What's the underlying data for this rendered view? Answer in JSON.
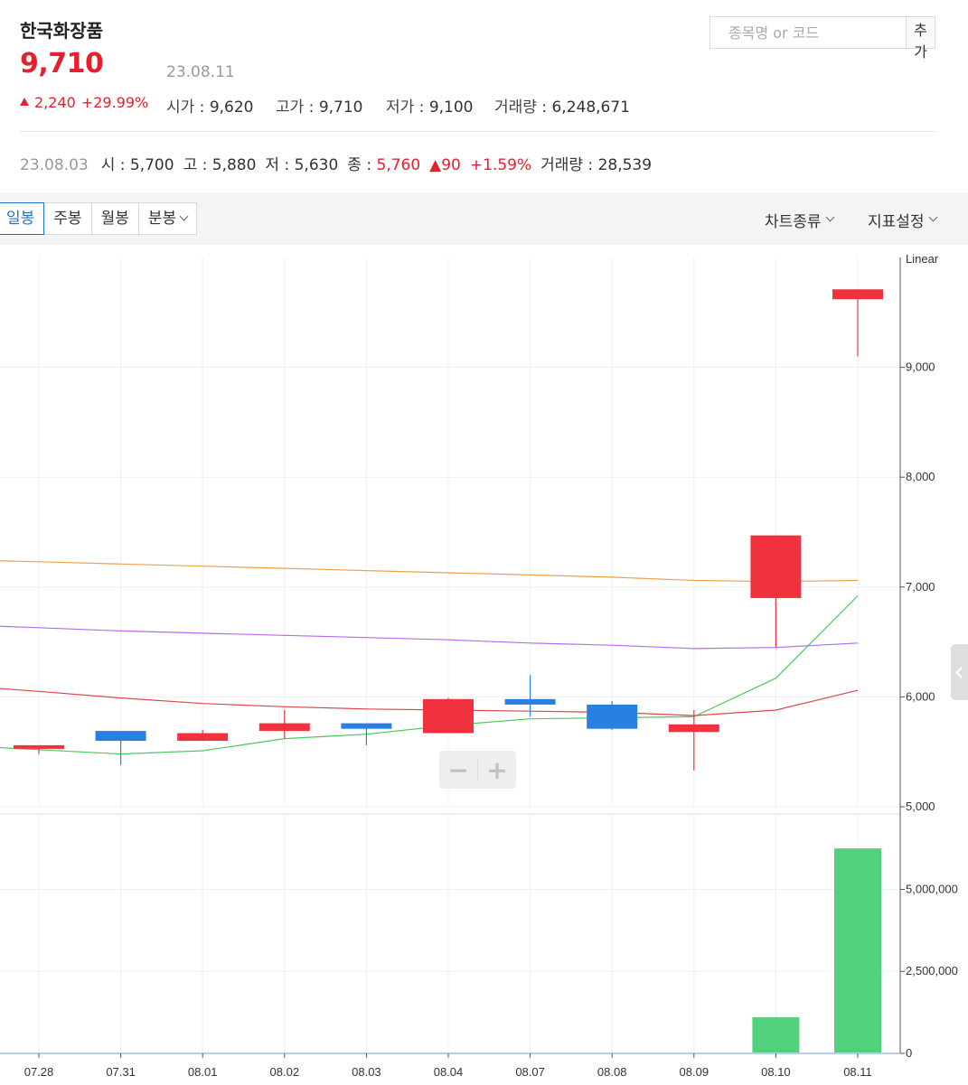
{
  "header": {
    "name": "한국화장품",
    "price": "9,710",
    "date": "23.08.11",
    "change": "2,240",
    "change_pct": "+29.99%",
    "open_label": "시가",
    "open": "9,620",
    "high_label": "고가",
    "high": "9,710",
    "low_label": "저가",
    "low": "9,100",
    "volume_label": "거래량",
    "volume": "6,248,671"
  },
  "prev_day": {
    "date": "23.08.03",
    "open_label": "시",
    "open": "5,700",
    "high_label": "고",
    "high": "5,880",
    "low_label": "저",
    "low": "5,630",
    "close_label": "종",
    "close": "5,760",
    "change": "▲90",
    "change_pct": "+1.59%",
    "volume_label": "거래량",
    "volume": "28,539"
  },
  "search": {
    "placeholder": "종목명 or 코드",
    "button": "추가"
  },
  "toolbar": {
    "periods": [
      "일봉",
      "주봉",
      "월봉",
      "분봉"
    ],
    "chart_type": "차트종류",
    "indicator": "지표설정"
  },
  "zoom": {
    "minus": "−",
    "plus": "+"
  },
  "colors": {
    "up": "#f0323f",
    "down": "#2a80e0",
    "volume": "#52d17c",
    "ma5": "#4cc95e",
    "ma20": "#e0474b",
    "ma60": "#b26cf0",
    "ma120": "#f0a04a"
  },
  "chart_data": {
    "type": "candlestick",
    "scale_label": "Linear",
    "dates": [
      "07.28",
      "07.31",
      "08.01",
      "08.02",
      "08.03",
      "08.04",
      "08.07",
      "08.08",
      "08.09",
      "08.10",
      "08.11"
    ],
    "ohlc": [
      {
        "o": 5530,
        "h": 5560,
        "l": 5480,
        "c": 5560
      },
      {
        "o": 5690,
        "h": 5690,
        "l": 5380,
        "c": 5600
      },
      {
        "o": 5600,
        "h": 5700,
        "l": 5600,
        "c": 5670
      },
      {
        "o": 5690,
        "h": 5880,
        "l": 5620,
        "c": 5760
      },
      {
        "o": 5760,
        "h": 5760,
        "l": 5560,
        "c": 5710
      },
      {
        "o": 5670,
        "h": 5990,
        "l": 5670,
        "c": 5980
      },
      {
        "o": 5980,
        "h": 6200,
        "l": 5820,
        "c": 5930
      },
      {
        "o": 5930,
        "h": 5960,
        "l": 5700,
        "c": 5710
      },
      {
        "o": 5680,
        "h": 5880,
        "l": 5330,
        "c": 5750
      },
      {
        "o": 6900,
        "h": 7470,
        "l": 6450,
        "c": 7470
      },
      {
        "o": 9620,
        "h": 9710,
        "l": 9100,
        "c": 9710
      }
    ],
    "moving_averages": [
      {
        "name": "ma5",
        "values": [
          5520,
          5480,
          5510,
          5620,
          5660,
          5740,
          5800,
          5810,
          5820,
          6170,
          6920
        ]
      },
      {
        "name": "ma20",
        "values": [
          6050,
          5990,
          5940,
          5910,
          5890,
          5880,
          5870,
          5860,
          5830,
          5880,
          6060
        ]
      },
      {
        "name": "ma60",
        "values": [
          6630,
          6600,
          6580,
          6560,
          6540,
          6520,
          6490,
          6470,
          6440,
          6450,
          6490
        ]
      },
      {
        "name": "ma120",
        "values": [
          7230,
          7210,
          7190,
          7170,
          7150,
          7130,
          7110,
          7090,
          7060,
          7050,
          7060
        ]
      }
    ],
    "price_ylim": [
      5000,
      10000
    ],
    "price_ticks": [
      5000,
      6000,
      7000,
      8000,
      9000
    ],
    "price_tick_labels": [
      "5,000",
      "6,000",
      "7,000",
      "8,000",
      "9,000"
    ],
    "volume": [
      0,
      0,
      0,
      0,
      0,
      0,
      0,
      0,
      0,
      1100000,
      6248671
    ],
    "volume_ylim": [
      0,
      7300000
    ],
    "volume_ticks": [
      0,
      2500000,
      5000000
    ],
    "volume_tick_labels": [
      "0",
      "2,500,000",
      "5,000,000"
    ],
    "grid": true
  }
}
